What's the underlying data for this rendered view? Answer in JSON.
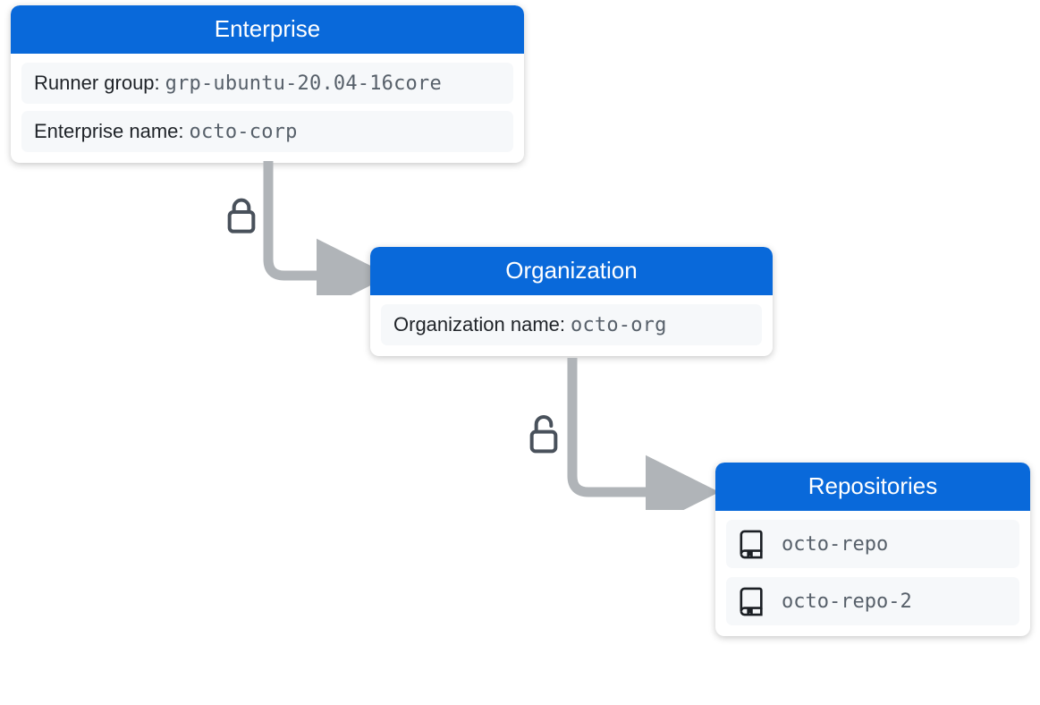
{
  "colors": {
    "accent": "#0969DA",
    "fieldBg": "#F6F8FA",
    "mono": "#57606A",
    "connector": "#B0B4B8"
  },
  "enterprise": {
    "title": "Enterprise",
    "runner_group_label": "Runner group:",
    "runner_group_value": "grp-ubuntu-20.04-16core",
    "name_label": "Enterprise name:",
    "name_value": "octo-corp"
  },
  "organization": {
    "title": "Organization",
    "name_label": "Organization name:",
    "name_value": "octo-org"
  },
  "repositories": {
    "title": "Repositories",
    "items": [
      {
        "name": "octo-repo"
      },
      {
        "name": "octo-repo-2"
      }
    ]
  },
  "connectors": {
    "enterprise_to_org": {
      "lock_state": "locked"
    },
    "org_to_repos": {
      "lock_state": "unlocked"
    }
  }
}
